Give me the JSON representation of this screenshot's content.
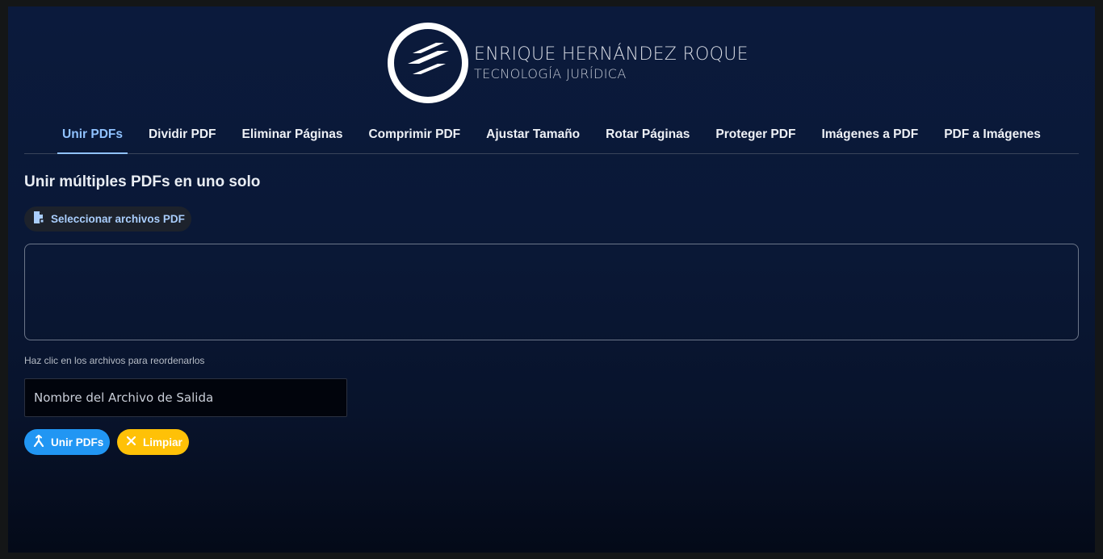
{
  "brand": {
    "name": "ENRIQUE HERNÁNDEZ ROQUE",
    "subtitle": "TECNOLOGÍA JURÍDICA",
    "logo_icon": "logo-stripes-icon"
  },
  "tabs": [
    {
      "label": "Unir PDFs",
      "active": true
    },
    {
      "label": "Dividir PDF",
      "active": false
    },
    {
      "label": "Eliminar Páginas",
      "active": false
    },
    {
      "label": "Comprimir PDF",
      "active": false
    },
    {
      "label": "Ajustar Tamaño",
      "active": false
    },
    {
      "label": "Rotar Páginas",
      "active": false
    },
    {
      "label": "Proteger PDF",
      "active": false
    },
    {
      "label": "Imágenes a PDF",
      "active": false
    },
    {
      "label": "PDF a Imágenes",
      "active": false
    }
  ],
  "main": {
    "title": "Unir múltiples PDFs en uno solo",
    "select_button": {
      "label": "Seleccionar archivos PDF",
      "icon": "file-pdf-icon"
    },
    "hint": "Haz clic en los archivos para reordenarlos",
    "output_field": {
      "value": "",
      "placeholder": "Nombre del Archivo de Salida"
    },
    "merge_button": {
      "label": "Unir PDFs",
      "icon": "merge-icon"
    },
    "clear_button": {
      "label": "Limpiar",
      "icon": "close-icon"
    }
  },
  "colors": {
    "accent": "#90c2ff",
    "primary_button": "#2196f3",
    "warning_button": "#ffc107",
    "background": "#0a1836"
  }
}
